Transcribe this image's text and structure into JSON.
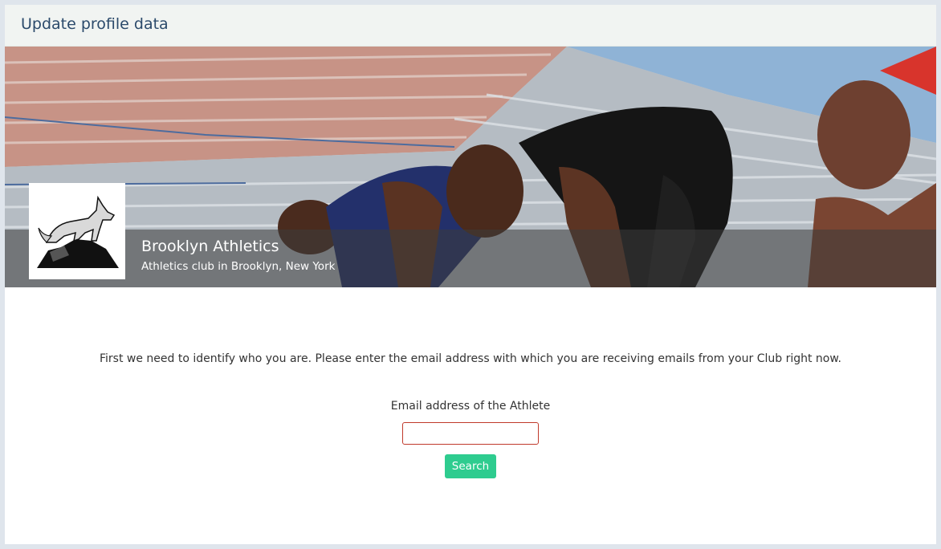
{
  "header": {
    "title": "Update profile data"
  },
  "club": {
    "name": "Brooklyn Athletics",
    "subtitle": "Athletics club in Brooklyn, New York",
    "logo_icon": "wolf-on-rock-icon"
  },
  "banner": {
    "image": "sprinters-in-starting-blocks-photo"
  },
  "form": {
    "intro": "First we need to identify who you are. Please enter the email address with which you are receiving emails from your Club right now.",
    "email_label": "Email address of the Athlete",
    "email_value": "",
    "email_placeholder": "",
    "search_label": "Search"
  },
  "colors": {
    "title": "#2b4a6b",
    "button": "#2ecc8f",
    "input_border": "#c0392b"
  }
}
